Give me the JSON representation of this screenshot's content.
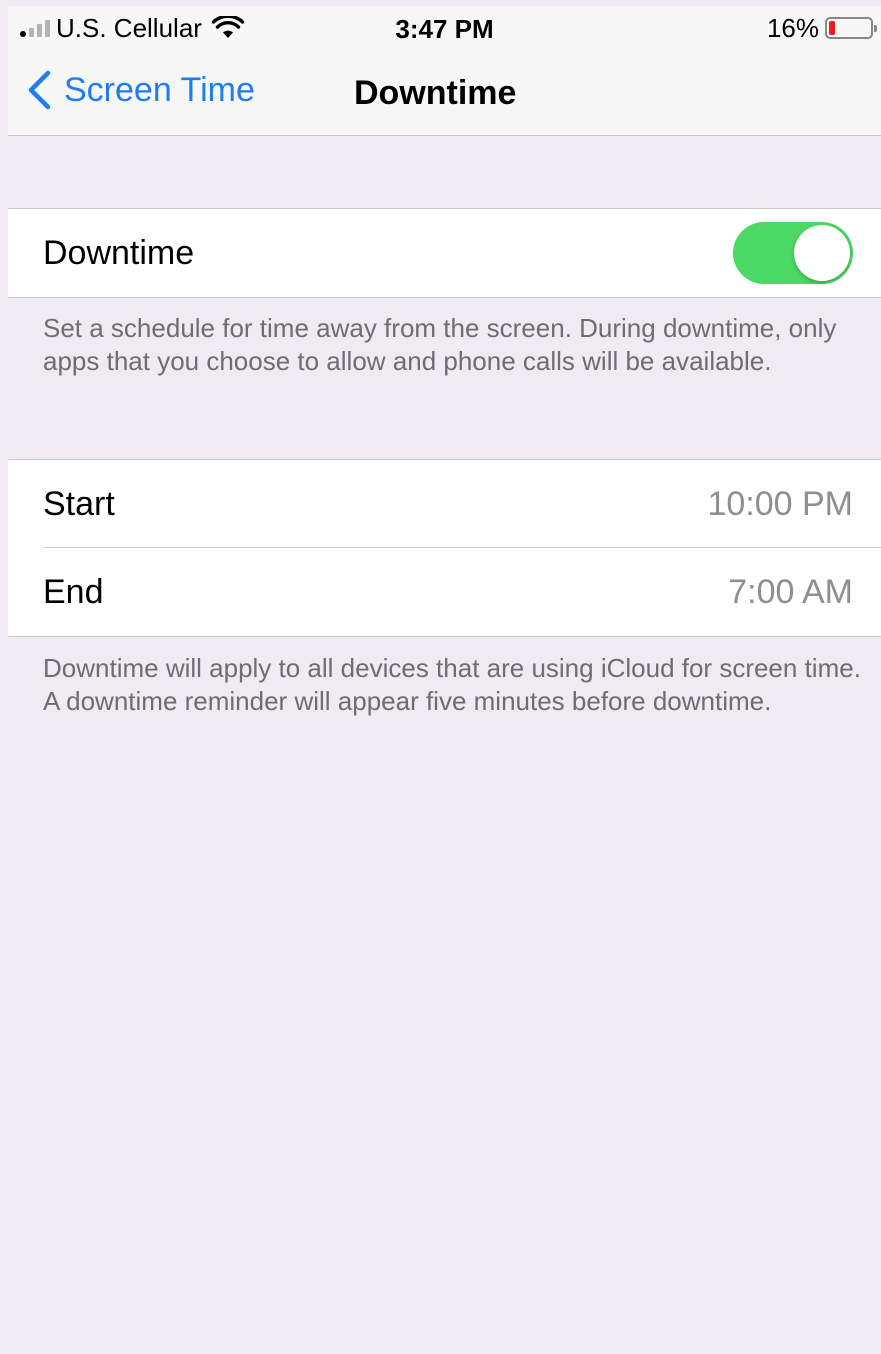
{
  "status_bar": {
    "carrier": "U.S. Cellular",
    "time": "3:47 PM",
    "battery_percent": "16%",
    "battery_level": 0.16,
    "battery_color": "#f0191d",
    "icons": [
      "signal-icon",
      "wifi-icon",
      "battery-icon"
    ]
  },
  "nav": {
    "back_label": "Screen Time",
    "title": "Downtime",
    "accent_color": "#1f7cf4"
  },
  "downtime_toggle": {
    "label": "Downtime",
    "on": true,
    "on_color": "#4cd864"
  },
  "downtime_description": "Set a schedule for time away from the screen. During downtime, only apps that you choose to allow and phone calls will be available.",
  "schedule": {
    "start_label": "Start",
    "start_value": "10:00 PM",
    "end_label": "End",
    "end_value": "7:00 AM"
  },
  "schedule_footer": "Downtime will apply to all devices that are using iCloud for screen time. A downtime reminder will appear five minutes before downtime."
}
